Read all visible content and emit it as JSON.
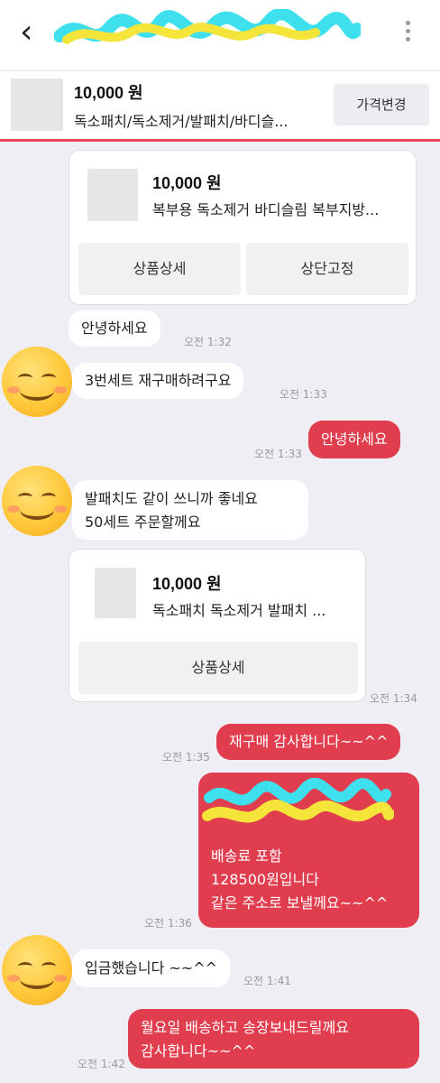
{
  "header": {
    "title": "",
    "back_icon": "chevron-left-icon",
    "more_icon": "more-vertical-icon"
  },
  "product": {
    "price": "10,000 원",
    "name": "독소패치/독소제거/발패치/바디슬...",
    "price_change_button": "가격변경"
  },
  "cards": [
    {
      "price": "10,000 원",
      "name": "복부용 독소제거 바디슬림 복부지방...",
      "detail_button": "상품상세",
      "pin_button": "상단고정"
    },
    {
      "price": "10,000 원",
      "name": "독소패치 독소제거 발패치 ...",
      "detail_button": "상품상세"
    }
  ],
  "messages": [
    {
      "from": "buyer",
      "text": "안녕하세요",
      "time": "오전 1:32"
    },
    {
      "from": "buyer",
      "text": "3번세트 재구매하려구요",
      "time": "오전 1:33"
    },
    {
      "from": "seller",
      "text": "안녕하세요",
      "time": "오전 1:33"
    },
    {
      "from": "buyer",
      "lines": [
        "발패치도 같이 쓰니까 좋네요",
        "50세트 주문할께요"
      ],
      "time": ""
    },
    {
      "from": "buyer_card",
      "time": "오전 1:34"
    },
    {
      "from": "seller",
      "text": "재구매 감사합니다~~^^",
      "time": "오전 1:35"
    },
    {
      "from": "seller",
      "lines": [
        "배송료 포함",
        "128500원입니다",
        "같은 주소로 보낼께요~~^^"
      ],
      "time": "오전 1:36"
    },
    {
      "from": "buyer",
      "text": "입금했습니다 ~~^^",
      "time": "오전 1:41"
    },
    {
      "from": "seller",
      "lines": [
        "월요일 배송하고 송장보내드릴께요",
        "감사합니다~~^^"
      ],
      "time": "오전 1:42"
    }
  ],
  "colors": {
    "accent": "#e03d4f",
    "divider": "#e8475c",
    "background": "#efeef4"
  }
}
